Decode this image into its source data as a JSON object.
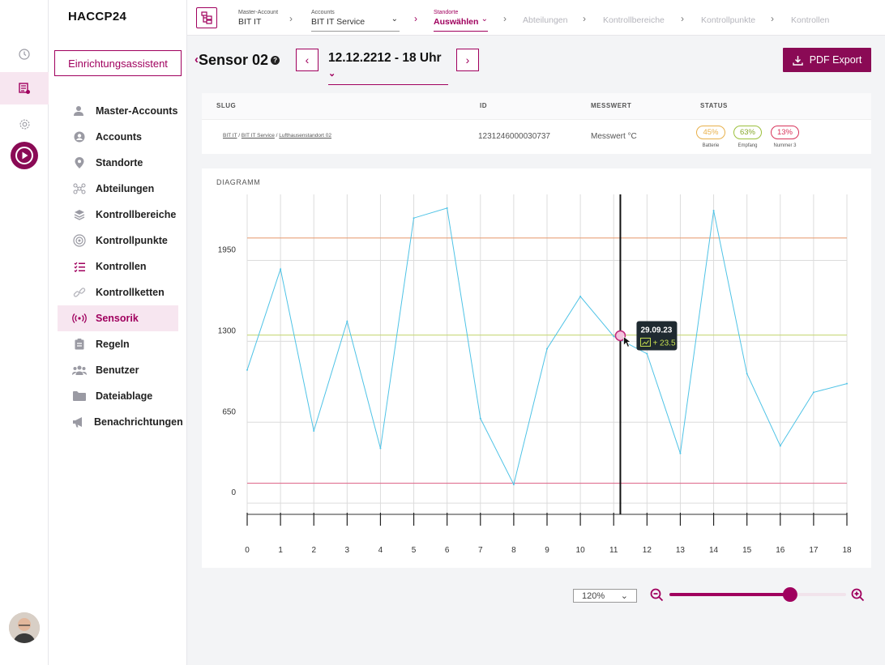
{
  "app": {
    "logo": "HACCP24"
  },
  "rail": {
    "icons": [
      "clock-icon",
      "list-icon",
      "gear-icon",
      "play-icon"
    ]
  },
  "sidebar": {
    "wizard_label": "Einrichtungsassistent",
    "items": [
      {
        "label": "Master-Accounts",
        "icon": "user-icon"
      },
      {
        "label": "Accounts",
        "icon": "account-icon"
      },
      {
        "label": "Standorte",
        "icon": "pin-icon"
      },
      {
        "label": "Abteilungen",
        "icon": "network-icon"
      },
      {
        "label": "Kontrollbereiche",
        "icon": "layers-icon"
      },
      {
        "label": "Kontrollpunkte",
        "icon": "target-icon"
      },
      {
        "label": "Kontrollen",
        "icon": "checklist-icon"
      },
      {
        "label": "Kontrollketten",
        "icon": "chain-icon"
      },
      {
        "label": "Sensorik",
        "icon": "sensor-icon",
        "active": true
      },
      {
        "label": "Regeln",
        "icon": "clipboard-icon"
      },
      {
        "label": "Benutzer",
        "icon": "users-icon"
      },
      {
        "label": "Dateiablage",
        "icon": "folder-icon"
      },
      {
        "label": "Benachrichtungen",
        "icon": "megaphone-icon"
      }
    ]
  },
  "breadcrumb": {
    "master_small": "Master-Account",
    "master_value": "BIT IT",
    "accounts_small": "Accounts",
    "accounts_value": "BIT IT Service",
    "standorte_small": "Standorte",
    "standorte_value": "Auswählen",
    "rest": [
      "Abteilungen",
      "Kontrollbereiche",
      "Kontrollpunkte",
      "Kontrollen"
    ]
  },
  "header": {
    "title": "Sensor 02",
    "date": "12.12.2212 - 18 Uhr",
    "pdf_label": "PDF Export"
  },
  "table": {
    "columns": [
      "SLUG",
      "ID",
      "MESSWERT",
      "STATUS"
    ],
    "row": {
      "slug": [
        "BIT IT",
        "BIT IT Service",
        "Lufthausenstandort 02"
      ],
      "id": "1231246000030737",
      "messwert": "Messwert °C",
      "status": [
        {
          "value": "45%",
          "label": "Batterie",
          "color": "#e8b04a"
        },
        {
          "value": "63%",
          "label": "Empfang",
          "color": "#9cc03c"
        },
        {
          "value": "13%",
          "label": "Nummer 3",
          "color": "#d8335a"
        }
      ]
    }
  },
  "chart_title": "DIAGRAMM",
  "chart_data": {
    "type": "line",
    "x": [
      0,
      1,
      2,
      3,
      4,
      5,
      6,
      7,
      8,
      9,
      10,
      11,
      12,
      13,
      14,
      15,
      16,
      17,
      18
    ],
    "y": [
      1070,
      1880,
      580,
      1460,
      440,
      2290,
      2370,
      680,
      150,
      1240,
      1660,
      1340,
      1200,
      400,
      2350,
      1040,
      460,
      890,
      960
    ],
    "yticks": [
      0,
      650,
      1300,
      1950
    ],
    "ylim": [
      -90,
      2480
    ],
    "thresholds": [
      {
        "value": 2130,
        "color": "#e8a27a"
      },
      {
        "value": 1350,
        "color": "#c8d878"
      },
      {
        "value": 160,
        "color": "#e07090"
      }
    ],
    "line_color": "#4fc3e6",
    "cursor_x": 11.2,
    "tooltip": {
      "date": "29.09.23",
      "value": "+ 23.5"
    }
  },
  "zoom": {
    "level": "120%",
    "slider_fraction": 0.69
  }
}
